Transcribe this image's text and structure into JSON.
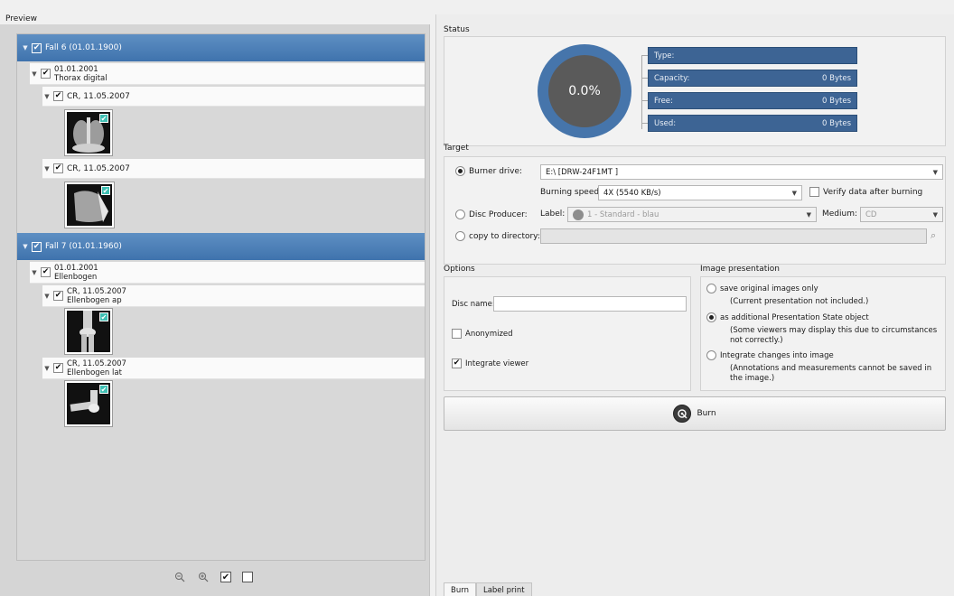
{
  "preview": {
    "title": "Preview",
    "tree": [
      {
        "type": "case",
        "label": "Fall 6 (01.01.1900)"
      },
      {
        "type": "study",
        "line1": "01.01.2001",
        "line2": "Thorax digital"
      },
      {
        "type": "series",
        "label": "CR, 11.05.2007"
      },
      {
        "type": "series",
        "label": "CR, 11.05.2007"
      },
      {
        "type": "case",
        "label": "Fall 7 (01.01.1960)"
      },
      {
        "type": "study",
        "line1": "01.01.2001",
        "line2": "Ellenbogen"
      },
      {
        "type": "series",
        "line1": "CR, 11.05.2007",
        "line2": "Ellenbogen ap"
      },
      {
        "type": "series",
        "line1": "CR, 11.05.2007",
        "line2": "Ellenbogen lat"
      }
    ],
    "check_glyph": "✔",
    "tools": {
      "zoom_out": "zoom-out-icon",
      "zoom_in": "zoom-in-icon",
      "check_all": "check-all-icon",
      "uncheck_all": "uncheck-all-icon"
    }
  },
  "status": {
    "title": "Status",
    "percent": "0.0%",
    "rows": [
      {
        "label": "Type:",
        "value": ""
      },
      {
        "label": "Capacity:",
        "value": "0 Bytes"
      },
      {
        "label": "Free:",
        "value": "0 Bytes"
      },
      {
        "label": "Used:",
        "value": "0 Bytes"
      }
    ]
  },
  "target": {
    "title": "Target",
    "burner_drive_label": "Burner drive:",
    "burner_drive_value": "E:\\ [DRW-24F1MT    ]",
    "burning_speed_label": "Burning speed:",
    "burning_speed_value": "4X (5540 KB/s)",
    "verify_label": "Verify data after burning",
    "disc_producer_label": "Disc Producer:",
    "label_label": "Label:",
    "label_value": "1 - Standard - blau",
    "medium_label": "Medium:",
    "medium_value": "CD",
    "copy_label": "copy to directory:",
    "copy_value": ""
  },
  "options": {
    "title": "Options",
    "disc_name_label": "Disc name:",
    "disc_name_value": "",
    "anonymized_label": "Anonymized",
    "integrate_viewer_label": "Integrate viewer"
  },
  "presentation": {
    "title": "Image presentation",
    "opt1": "save original images only",
    "opt1_note": "(Current presentation not included.)",
    "opt2": "as additional Presentation State object",
    "opt2_note": "(Some viewers may display this due to circumstances not correctly.)",
    "opt3": "Integrate changes into image",
    "opt3_note": "(Annotations and measurements cannot be saved in the image.)"
  },
  "burn_button": "Burn",
  "tabs": [
    "Burn",
    "Label print"
  ]
}
